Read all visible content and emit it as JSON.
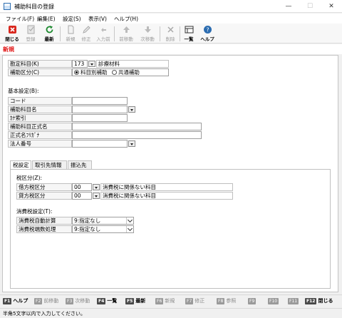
{
  "window": {
    "title": "補助科目の登録",
    "minimize": "—",
    "maximize": "☐",
    "close": "✕"
  },
  "menu": [
    "ファイル(F)",
    "編集(E)",
    "設定(S)",
    "表示(V)",
    "ヘルプ(H)"
  ],
  "toolbar": {
    "close": "閉じる",
    "register": "登録",
    "refresh": "最新",
    "new": "新規",
    "edit": "修正",
    "input_prev": "入力前",
    "prev": "前移動",
    "next": "次移動",
    "delete": "削除",
    "list": "一覧",
    "help": "ヘルプ"
  },
  "mode": "新規",
  "account": {
    "kanjo_label": "勘定科目(K)",
    "kanjo_code": "173",
    "kanjo_name": "診療材料",
    "kubun_label": "補助区分(C)",
    "radio_1": "科目別補助",
    "radio_2": "共通補助"
  },
  "basic": {
    "heading": "基本設定(B):",
    "code": "コード",
    "name": "補助科目名",
    "kana": "ｶﾅ索引",
    "formal": "補助科目正式名",
    "formal_kana": "正式名ﾌﾘｶﾞﾅ",
    "corp": "法人番号"
  },
  "tabs": [
    "税設定",
    "取引先情報",
    "振込先"
  ],
  "tax": {
    "heading": "税区分(Z):",
    "debit_label": "借方税区分",
    "debit_code": "00",
    "debit_desc": "消費税に関係ない科目",
    "credit_label": "貸方税区分",
    "credit_code": "00",
    "credit_desc": "消費税に関係ない科目",
    "cons_heading": "消費税設定(T):",
    "auto_label": "消費税自動計算",
    "auto_value": "9:指定なし",
    "round_label": "消費税端数処理",
    "round_value": "9:指定なし"
  },
  "fkeys": [
    {
      "key": "F1",
      "label": "ヘルプ"
    },
    {
      "key": "F2",
      "label": "前移動"
    },
    {
      "key": "F3",
      "label": "次移動"
    },
    {
      "key": "F4",
      "label": "一覧"
    },
    {
      "key": "F5",
      "label": "最新"
    },
    {
      "key": "F6",
      "label": "新規"
    },
    {
      "key": "F7",
      "label": "修正"
    },
    {
      "key": "F8",
      "label": "参照"
    },
    {
      "key": "F9",
      "label": ""
    },
    {
      "key": "F10",
      "label": ""
    },
    {
      "key": "F11",
      "label": ""
    },
    {
      "key": "F12",
      "label": "閉じる"
    }
  ],
  "status": "半角5文字以内で入力してください。",
  "colors": {
    "mode": "#e01010",
    "accent": "#2b6cb0"
  }
}
